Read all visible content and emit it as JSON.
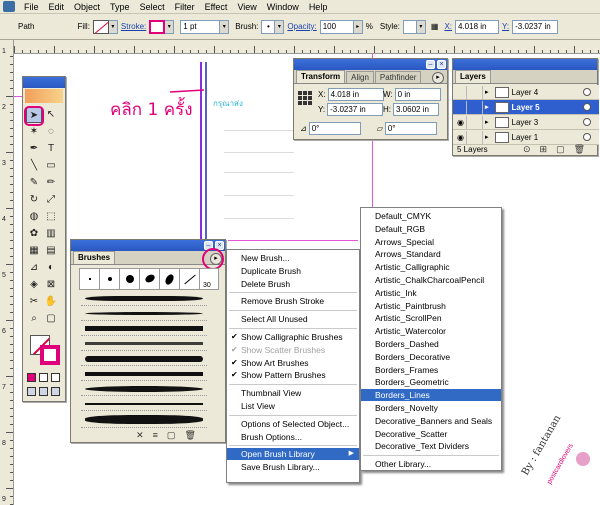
{
  "menubar": {
    "items": [
      "File",
      "Edit",
      "Object",
      "Type",
      "Select",
      "Filter",
      "Effect",
      "View",
      "Window",
      "Help"
    ]
  },
  "controlbar": {
    "object_type": "Path",
    "fill_label": "Fill:",
    "stroke_label": "Stroke:",
    "stroke_weight": "1 pt",
    "brush_label": "Brush:",
    "opacity_label": "Opacity:",
    "opacity_value": "100",
    "percent": "%",
    "style_label": "Style:",
    "x_label": "X:",
    "x_value": "4.018 in",
    "y_label": "Y:",
    "y_value": "-3.0237 in"
  },
  "rulers": {
    "left_numbers": [
      "1",
      "2",
      "3",
      "4",
      "5",
      "6",
      "7",
      "8",
      "9"
    ]
  },
  "annotations": {
    "click_once": "คลิก 1 ครั้ง",
    "small_label": "กรุณาส่ง"
  },
  "transform_panel": {
    "tabs": [
      "Transform",
      "Align",
      "Pathfinder"
    ],
    "x_label": "X:",
    "x_value": "4.018 in",
    "w_label": "W:",
    "w_value": "0 in",
    "y_label": "Y:",
    "y_value": "-3.0237 in",
    "h_label": "H:",
    "h_value": "3.0602 in",
    "rotate_value": "0°",
    "shear_value": "0°"
  },
  "layers_panel": {
    "tab": "Layers",
    "layers": [
      {
        "name": "Layer 4",
        "visible": false,
        "selected": false
      },
      {
        "name": "Layer 5",
        "visible": false,
        "selected": true
      },
      {
        "name": "Layer 3",
        "visible": true,
        "selected": false
      },
      {
        "name": "Layer 1",
        "visible": true,
        "selected": false
      }
    ],
    "footer": "5 Layers"
  },
  "brushes_panel": {
    "tab": "Brushes",
    "brush_size_label": "30"
  },
  "flyout_menu": {
    "items": [
      {
        "label": "New Brush...",
        "type": "item"
      },
      {
        "label": "Duplicate Brush",
        "type": "item"
      },
      {
        "label": "Delete Brush",
        "type": "item"
      },
      {
        "type": "sep"
      },
      {
        "label": "Remove Brush Stroke",
        "type": "item"
      },
      {
        "type": "sep"
      },
      {
        "label": "Select All Unused",
        "type": "item"
      },
      {
        "type": "sep"
      },
      {
        "label": "Show Calligraphic Brushes",
        "type": "item",
        "checked": true
      },
      {
        "label": "Show Scatter Brushes",
        "type": "item",
        "checked": true,
        "disabled": true
      },
      {
        "label": "Show Art Brushes",
        "type": "item",
        "checked": true
      },
      {
        "label": "Show Pattern Brushes",
        "type": "item",
        "checked": true
      },
      {
        "type": "sep"
      },
      {
        "label": "Thumbnail View",
        "type": "item"
      },
      {
        "label": "List View",
        "type": "item"
      },
      {
        "type": "sep"
      },
      {
        "label": "Options of Selected Object...",
        "type": "item"
      },
      {
        "label": "Brush Options...",
        "type": "item"
      },
      {
        "type": "sep"
      },
      {
        "label": "Open Brush Library",
        "type": "item",
        "submenu": true,
        "highlighted": true
      },
      {
        "label": "Save Brush Library...",
        "type": "item"
      }
    ]
  },
  "library_submenu": {
    "items": [
      {
        "label": "Default_CMYK"
      },
      {
        "label": "Default_RGB"
      },
      {
        "label": "Arrows_Special"
      },
      {
        "label": "Arrows_Standard"
      },
      {
        "label": "Artistic_Calligraphic"
      },
      {
        "label": "Artistic_ChalkCharcoalPencil"
      },
      {
        "label": "Artistic_Ink"
      },
      {
        "label": "Artistic_Paintbrush"
      },
      {
        "label": "Artistic_ScrollPen"
      },
      {
        "label": "Artistic_Watercolor"
      },
      {
        "label": "Borders_Dashed"
      },
      {
        "label": "Borders_Decorative"
      },
      {
        "label": "Borders_Frames"
      },
      {
        "label": "Borders_Geometric"
      },
      {
        "label": "Borders_Lines",
        "highlighted": true
      },
      {
        "label": "Borders_Novelty"
      },
      {
        "label": "Decorative_Banners and Seals"
      },
      {
        "label": "Decorative_Scatter"
      },
      {
        "label": "Decorative_Text Dividers"
      },
      {
        "type": "sep"
      },
      {
        "label": "Other Library..."
      }
    ]
  },
  "watermark": {
    "line1": "By : fantanan",
    "line2": "postcardlovers"
  },
  "colors": {
    "accent": "#e0007a",
    "highlight": "#316ac5",
    "title_bar": "#2a58c2",
    "guide": "#e455d8"
  }
}
